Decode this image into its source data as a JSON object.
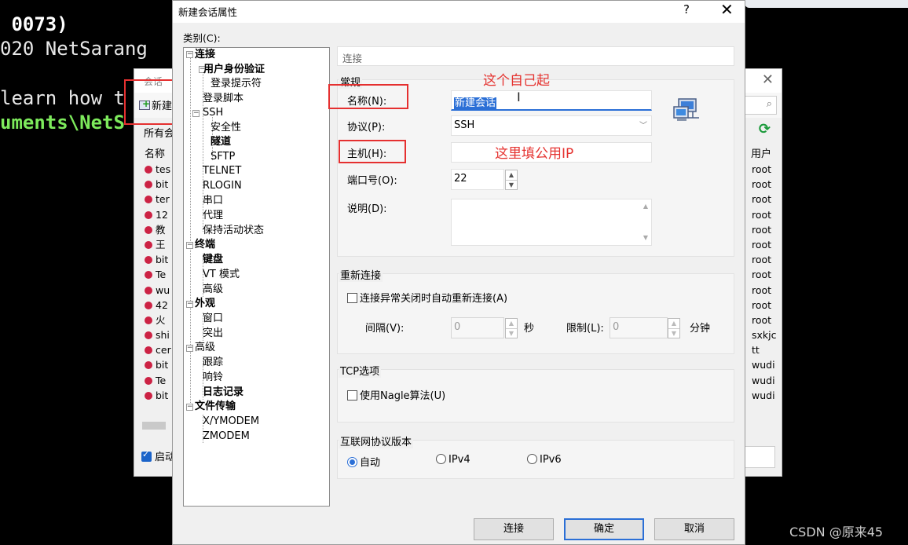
{
  "terminal": {
    "lines": [
      " 0073)",
      "020 NetSarang",
      "learn how t",
      "uments\\NetS"
    ]
  },
  "session_manager": {
    "title": "会话",
    "new_label": "新建",
    "all_sessions": "所有会",
    "col_name": "名称",
    "col_user": "用户",
    "names": [
      "tes",
      "bit",
      "ter",
      "12",
      "教",
      "王",
      "bit",
      "Te",
      "wu",
      "42",
      "火",
      "shi",
      "cer",
      "bit",
      "Te",
      "bit"
    ],
    "users": [
      "root",
      "root",
      "root",
      "root",
      "root",
      "root",
      "root",
      "root",
      "root",
      "root",
      "root",
      "sxkjc",
      "tt",
      "wudi",
      "wudi",
      "wudi"
    ],
    "startup_label": "启动"
  },
  "dialog": {
    "title": "新建会话属性",
    "help": "?",
    "close": "✕",
    "category_label": "类别(C):",
    "tree": {
      "connection": "连接",
      "user_auth": "用户身份验证",
      "login_prompt": "登录提示符",
      "login_script": "登录脚本",
      "ssh": "SSH",
      "security": "安全性",
      "tunnel": "隧道",
      "sftp": "SFTP",
      "telnet": "TELNET",
      "rlogin": "RLOGIN",
      "serial": "串口",
      "proxy": "代理",
      "keepalive": "保持活动状态",
      "terminal": "终端",
      "keyboard": "键盘",
      "vt_mode": "VT 模式",
      "advanced": "高级",
      "appearance": "外观",
      "window": "窗口",
      "highlight": "突出",
      "advanced2": "高级",
      "trace": "跟踪",
      "bell": "响铃",
      "logging": "日志记录",
      "file_transfer": "文件传输",
      "xymodem": "X/YMODEM",
      "zmodem": "ZMODEM"
    },
    "panel_title": "连接",
    "general": {
      "legend": "常规",
      "name_label": "名称(N):",
      "name_value": "新建会话",
      "protocol_label": "协议(P):",
      "protocol_value": "SSH",
      "host_label": "主机(H):",
      "host_value": "",
      "port_label": "端口号(O):",
      "port_value": "22",
      "desc_label": "说明(D):",
      "desc_value": ""
    },
    "reconnect": {
      "legend": "重新连接",
      "checkbox_label": "连接异常关闭时自动重新连接(A)",
      "interval_label": "间隔(V):",
      "interval_value": "0",
      "interval_unit": "秒",
      "limit_label": "限制(L):",
      "limit_value": "0",
      "limit_unit": "分钟"
    },
    "tcp": {
      "legend": "TCP选项",
      "nagle_label": "使用Nagle算法(U)"
    },
    "ip_version": {
      "legend": "互联网协议版本",
      "auto": "自动",
      "ipv4": "IPv4",
      "ipv6": "IPv6",
      "selected": "自动"
    },
    "buttons": {
      "connect": "连接",
      "ok": "确定",
      "cancel": "取消"
    }
  },
  "annotations": {
    "name_note": "这个自己起",
    "host_note": "这里填公用IP",
    "color": "#e5322f"
  },
  "watermark": "CSDN @原来45"
}
